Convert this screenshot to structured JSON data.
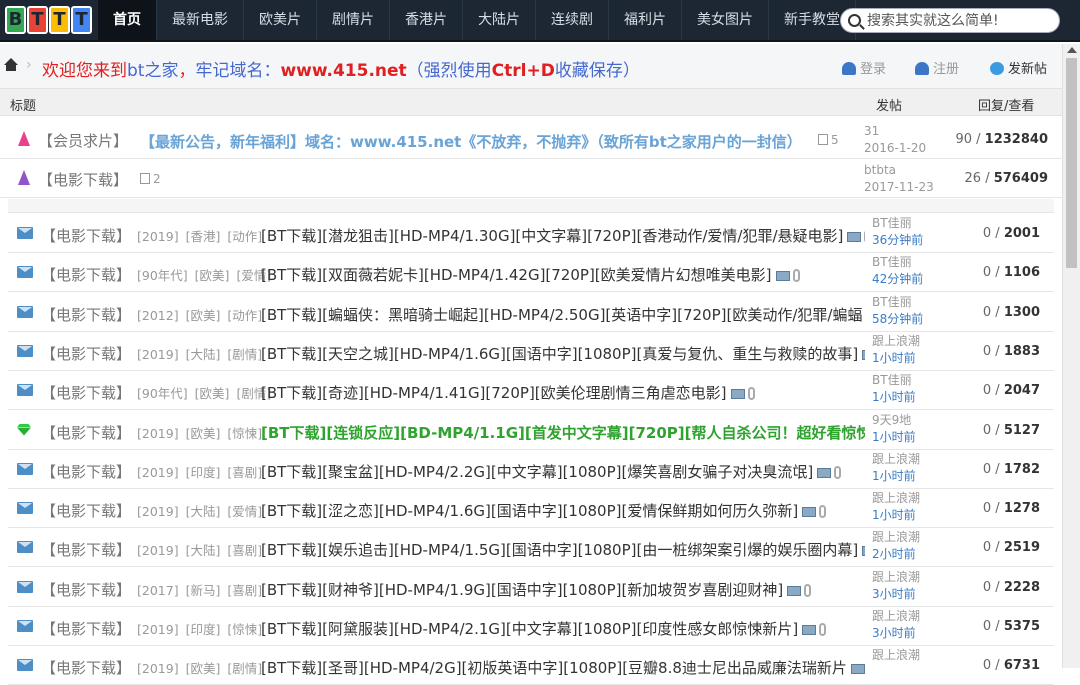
{
  "logo": "BTTT",
  "nav": [
    "首页",
    "最新电影",
    "欧美片",
    "剧情片",
    "香港片",
    "大陆片",
    "连续剧",
    "福利片",
    "美女图片",
    "新手教堂"
  ],
  "search": {
    "placeholder": "搜索其实就这么简单!"
  },
  "welcome": {
    "t1": "欢迎您来到",
    "t2": "bt之家",
    "t3": "，",
    "t4": "牢记域名：",
    "domain": "www.415.net",
    "t5": "（强烈使用",
    "key": "Ctrl+D",
    "t6": "收藏保存）"
  },
  "actions": {
    "login": "登录",
    "register": "注册",
    "post": "发新帖"
  },
  "header": {
    "title": "标题",
    "poster": "发帖",
    "replies": "回复/查看"
  },
  "pinned": [
    {
      "icon": "pink",
      "cat": "【会员求片】",
      "title": "【最新公告，新年福利】域名：www.415.net《不放弃，不抛弃》（致所有bt之家用户的一封信）",
      "count": "5",
      "author": "31",
      "time": "2016-1-20",
      "rep": "90",
      "views": "1232840"
    },
    {
      "icon": "purple",
      "cat": "【电影下载】",
      "title": "",
      "count": "2",
      "author": "btbta",
      "time": "2017-11-23",
      "rep": "26",
      "views": "576409"
    }
  ],
  "rows": [
    {
      "icon": "env",
      "cat": "【电影下载】",
      "tags": [
        "[2019]",
        "[香港]",
        "[动作]"
      ],
      "title": "[BT下载][潜龙狙击][HD-MP4/1.30G][中文字幕][720P][香港动作/爱情/犯罪/悬疑电影]",
      "author": "BT佳丽",
      "time": "36分钟前",
      "rep": "0",
      "views": "2001"
    },
    {
      "icon": "env",
      "cat": "【电影下载】",
      "tags": [
        "[90年代]",
        "[欧美]",
        "[爱情]"
      ],
      "title": "[BT下载][双面薇若妮卡][HD-MP4/1.42G][720P][欧美爱情片幻想唯美电影]",
      "author": "BT佳丽",
      "time": "42分钟前",
      "rep": "0",
      "views": "1106"
    },
    {
      "icon": "env",
      "cat": "【电影下载】",
      "tags": [
        "[2012]",
        "[欧美]",
        "[动作]"
      ],
      "title": "[BT下载][蝙蝠侠：黑暗骑士崛起][HD-MP4/2.50G][英语中字][720P][欧美动作/犯罪/蝙蝠",
      "author": "BT佳丽",
      "time": "58分钟前",
      "rep": "0",
      "views": "1300"
    },
    {
      "icon": "env",
      "cat": "【电影下载】",
      "tags": [
        "[2019]",
        "[大陆]",
        "[剧情]"
      ],
      "title": "[BT下载][天空之城][HD-MP4/1.6G][国语中字][1080P][真爱与复仇、重生与救赎的故事]",
      "author": "跟上浪潮",
      "time": "1小时前",
      "rep": "0",
      "views": "1883"
    },
    {
      "icon": "env",
      "cat": "【电影下载】",
      "tags": [
        "[90年代]",
        "[欧美]",
        "[剧情]"
      ],
      "title": "[BT下载][奇迹][HD-MP4/1.41G][720P][欧美伦理剧情三角虐恋电影]",
      "author": "BT佳丽",
      "time": "1小时前",
      "rep": "0",
      "views": "2047"
    },
    {
      "icon": "gem",
      "cat": "【电影下载】",
      "tags": [
        "[2019]",
        "[欧美]",
        "[惊悚]"
      ],
      "title": "[BT下载][连锁反应][BD-MP4/1.1G][首发中文字幕][720P][帮人自杀公司！超好看惊悚片",
      "author": "9天9地",
      "time": "1小时前",
      "rep": "0",
      "views": "5127"
    },
    {
      "icon": "env",
      "cat": "【电影下载】",
      "tags": [
        "[2019]",
        "[印度]",
        "[喜剧]"
      ],
      "title": "[BT下载][聚宝盆][HD-MP4/2.2G][中文字幕][1080P][爆笑喜剧女骗子对决臭流氓]",
      "author": "跟上浪潮",
      "time": "1小时前",
      "rep": "0",
      "views": "1782"
    },
    {
      "icon": "env",
      "cat": "【电影下载】",
      "tags": [
        "[2019]",
        "[大陆]",
        "[爱情]"
      ],
      "title": "[BT下载][涩之恋][HD-MP4/1.6G][国语中字][1080P][爱情保鲜期如何历久弥新]",
      "author": "跟上浪潮",
      "time": "1小时前",
      "rep": "0",
      "views": "1278"
    },
    {
      "icon": "env",
      "cat": "【电影下载】",
      "tags": [
        "[2019]",
        "[大陆]",
        "[喜剧]"
      ],
      "title": "[BT下载][娱乐追击][HD-MP4/1.5G][国语中字][1080P][由一桩绑架案引爆的娱乐圈内幕]",
      "author": "跟上浪潮",
      "time": "2小时前",
      "rep": "0",
      "views": "2519"
    },
    {
      "icon": "env",
      "cat": "【电影下载】",
      "tags": [
        "[2017]",
        "[新马]",
        "[喜剧]"
      ],
      "title": "[BT下载][财神爷][HD-MP4/1.9G][国语中字][1080P][新加坡贺岁喜剧迎财神]",
      "author": "跟上浪潮",
      "time": "3小时前",
      "rep": "0",
      "views": "2228"
    },
    {
      "icon": "env",
      "cat": "【电影下载】",
      "tags": [
        "[2019]",
        "[印度]",
        "[惊悚]"
      ],
      "title": "[BT下载][阿黛服装][HD-MP4/2.1G][中文字幕][1080P][印度性感女郎惊悚新片]",
      "author": "跟上浪潮",
      "time": "3小时前",
      "rep": "0",
      "views": "5375"
    },
    {
      "icon": "env",
      "cat": "【电影下载】",
      "tags": [
        "[2019]",
        "[欧美]",
        "[剧情]"
      ],
      "title": "[BT下载][圣哥][HD-MP4/2G][初版英语中字][1080P][豆瓣8.8迪士尼出品威廉法瑞新片",
      "author": "跟上浪潮",
      "time": "",
      "rep": "0",
      "views": "6731"
    }
  ]
}
